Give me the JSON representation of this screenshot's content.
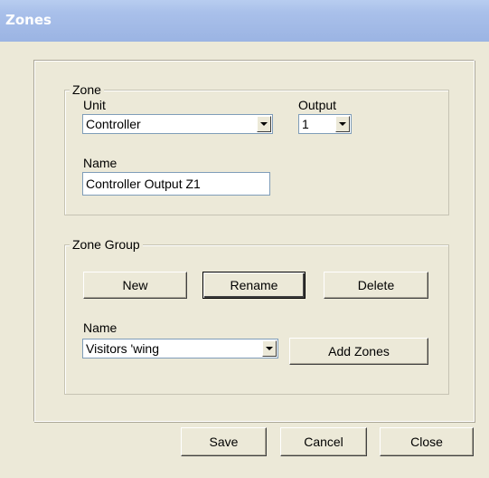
{
  "window": {
    "title": "Zones"
  },
  "zone_group_box": {
    "legend": "Zone",
    "unit_label": "Unit",
    "unit_value": "Controller",
    "output_label": "Output",
    "output_value": "1",
    "name_label": "Name",
    "name_value": "Controller Output Z1"
  },
  "zone_groups_box": {
    "legend": "Zone Group",
    "new_label": "New",
    "rename_label": "Rename",
    "delete_label": "Delete",
    "name_label": "Name",
    "name_value": "Visitors 'wing",
    "add_zones_label": "Add Zones"
  },
  "footer": {
    "save_label": "Save",
    "cancel_label": "Cancel",
    "close_label": "Close"
  },
  "colors": {
    "face": "#ece9d8",
    "title_gradient_top": "#b8cdf0",
    "title_gradient_bottom": "#9bb4e3",
    "input_border": "#7f9db9"
  }
}
